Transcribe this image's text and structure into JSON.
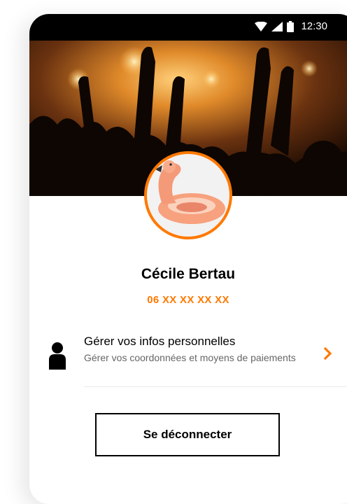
{
  "status_bar": {
    "time": "12:30",
    "icons": [
      "wifi-icon",
      "signal-icon",
      "battery-icon"
    ]
  },
  "hero": {
    "image": "concert-crowd-photo"
  },
  "profile": {
    "avatar": "flamingo-float-avatar",
    "name": "Cécile Bertau",
    "phone": "06 XX XX XX XX"
  },
  "menu": {
    "items": [
      {
        "title": "Gérer vos infos personnelles",
        "subtitle": "Gérer vos coordonnées et moyens de paiements",
        "icon": "person-icon"
      }
    ]
  },
  "actions": {
    "logout_label": "Se déconnecter"
  },
  "colors": {
    "accent": "#ff7900",
    "text": "#000000",
    "muted": "#666666"
  }
}
